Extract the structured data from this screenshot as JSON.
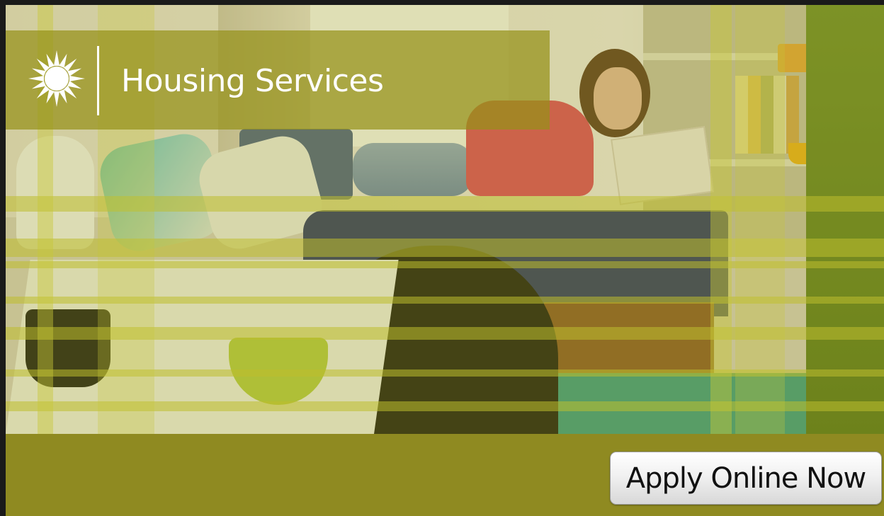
{
  "header": {
    "title": "Housing Services",
    "logo_icon": "sunburst-icon"
  },
  "cta": {
    "label": "Apply Online Now"
  },
  "colors": {
    "olive_bar": "#8f8a21",
    "header_overlay": "#96911a",
    "title_text": "#ffffff",
    "button_text": "#111111"
  }
}
